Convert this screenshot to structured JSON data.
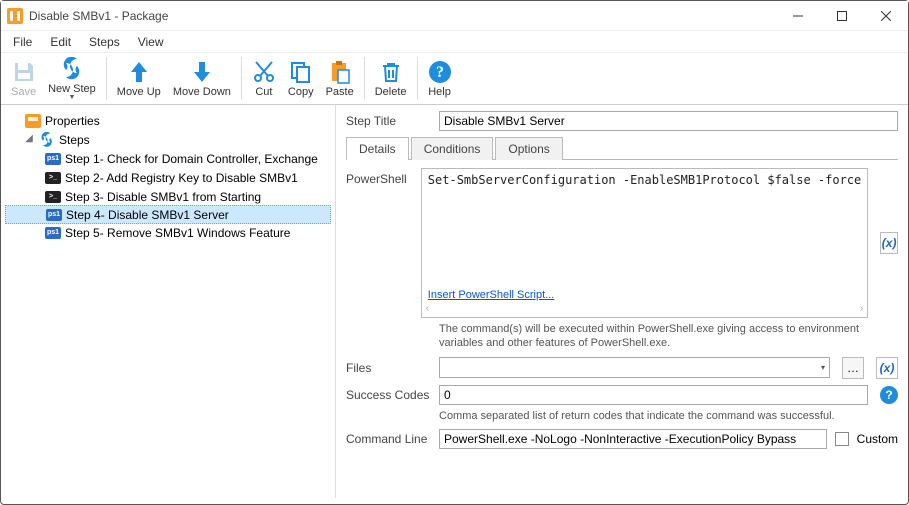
{
  "window": {
    "title": "Disable SMBv1 - Package"
  },
  "menu": [
    "File",
    "Edit",
    "Steps",
    "View"
  ],
  "toolbar": {
    "save": "Save",
    "new_step": "New Step",
    "move_up": "Move Up",
    "move_down": "Move Down",
    "cut": "Cut",
    "copy": "Copy",
    "paste": "Paste",
    "delete": "Delete",
    "help": "Help"
  },
  "tree": {
    "properties": "Properties",
    "steps_label": "Steps",
    "steps": [
      {
        "icon": "ps1",
        "label": "Step 1- Check for Domain Controller, Exchange"
      },
      {
        "icon": "cmd",
        "label": "Step 2- Add Registry Key to Disable SMBv1"
      },
      {
        "icon": "cmd",
        "label": "Step 3- Disable SMBv1 from Starting"
      },
      {
        "icon": "ps1",
        "label": "Step 4- Disable SMBv1 Server",
        "selected": true
      },
      {
        "icon": "ps1",
        "label": "Step 5- Remove SMBv1 Windows Feature"
      }
    ]
  },
  "panel": {
    "step_title_label": "Step Title",
    "step_title_value": "Disable SMBv1 Server",
    "tabs": [
      "Details",
      "Conditions",
      "Options"
    ],
    "powershell_label": "PowerShell",
    "powershell_code": "Set-SmbServerConfiguration -EnableSMB1Protocol $false -force",
    "insert_link": "Insert PowerShell Script...",
    "powershell_hint": "The command(s) will be executed within PowerShell.exe giving access to environment variables and other features of PowerShell.exe.",
    "files_label": "Files",
    "files_value": "",
    "success_label": "Success Codes",
    "success_value": "0",
    "success_hint": "Comma separated list of return codes that indicate the command was successful.",
    "commandline_label": "Command Line",
    "commandline_value": "PowerShell.exe -NoLogo -NonInteractive -ExecutionPolicy Bypass",
    "custom_label": "Custom",
    "var_btn": "(x)"
  }
}
